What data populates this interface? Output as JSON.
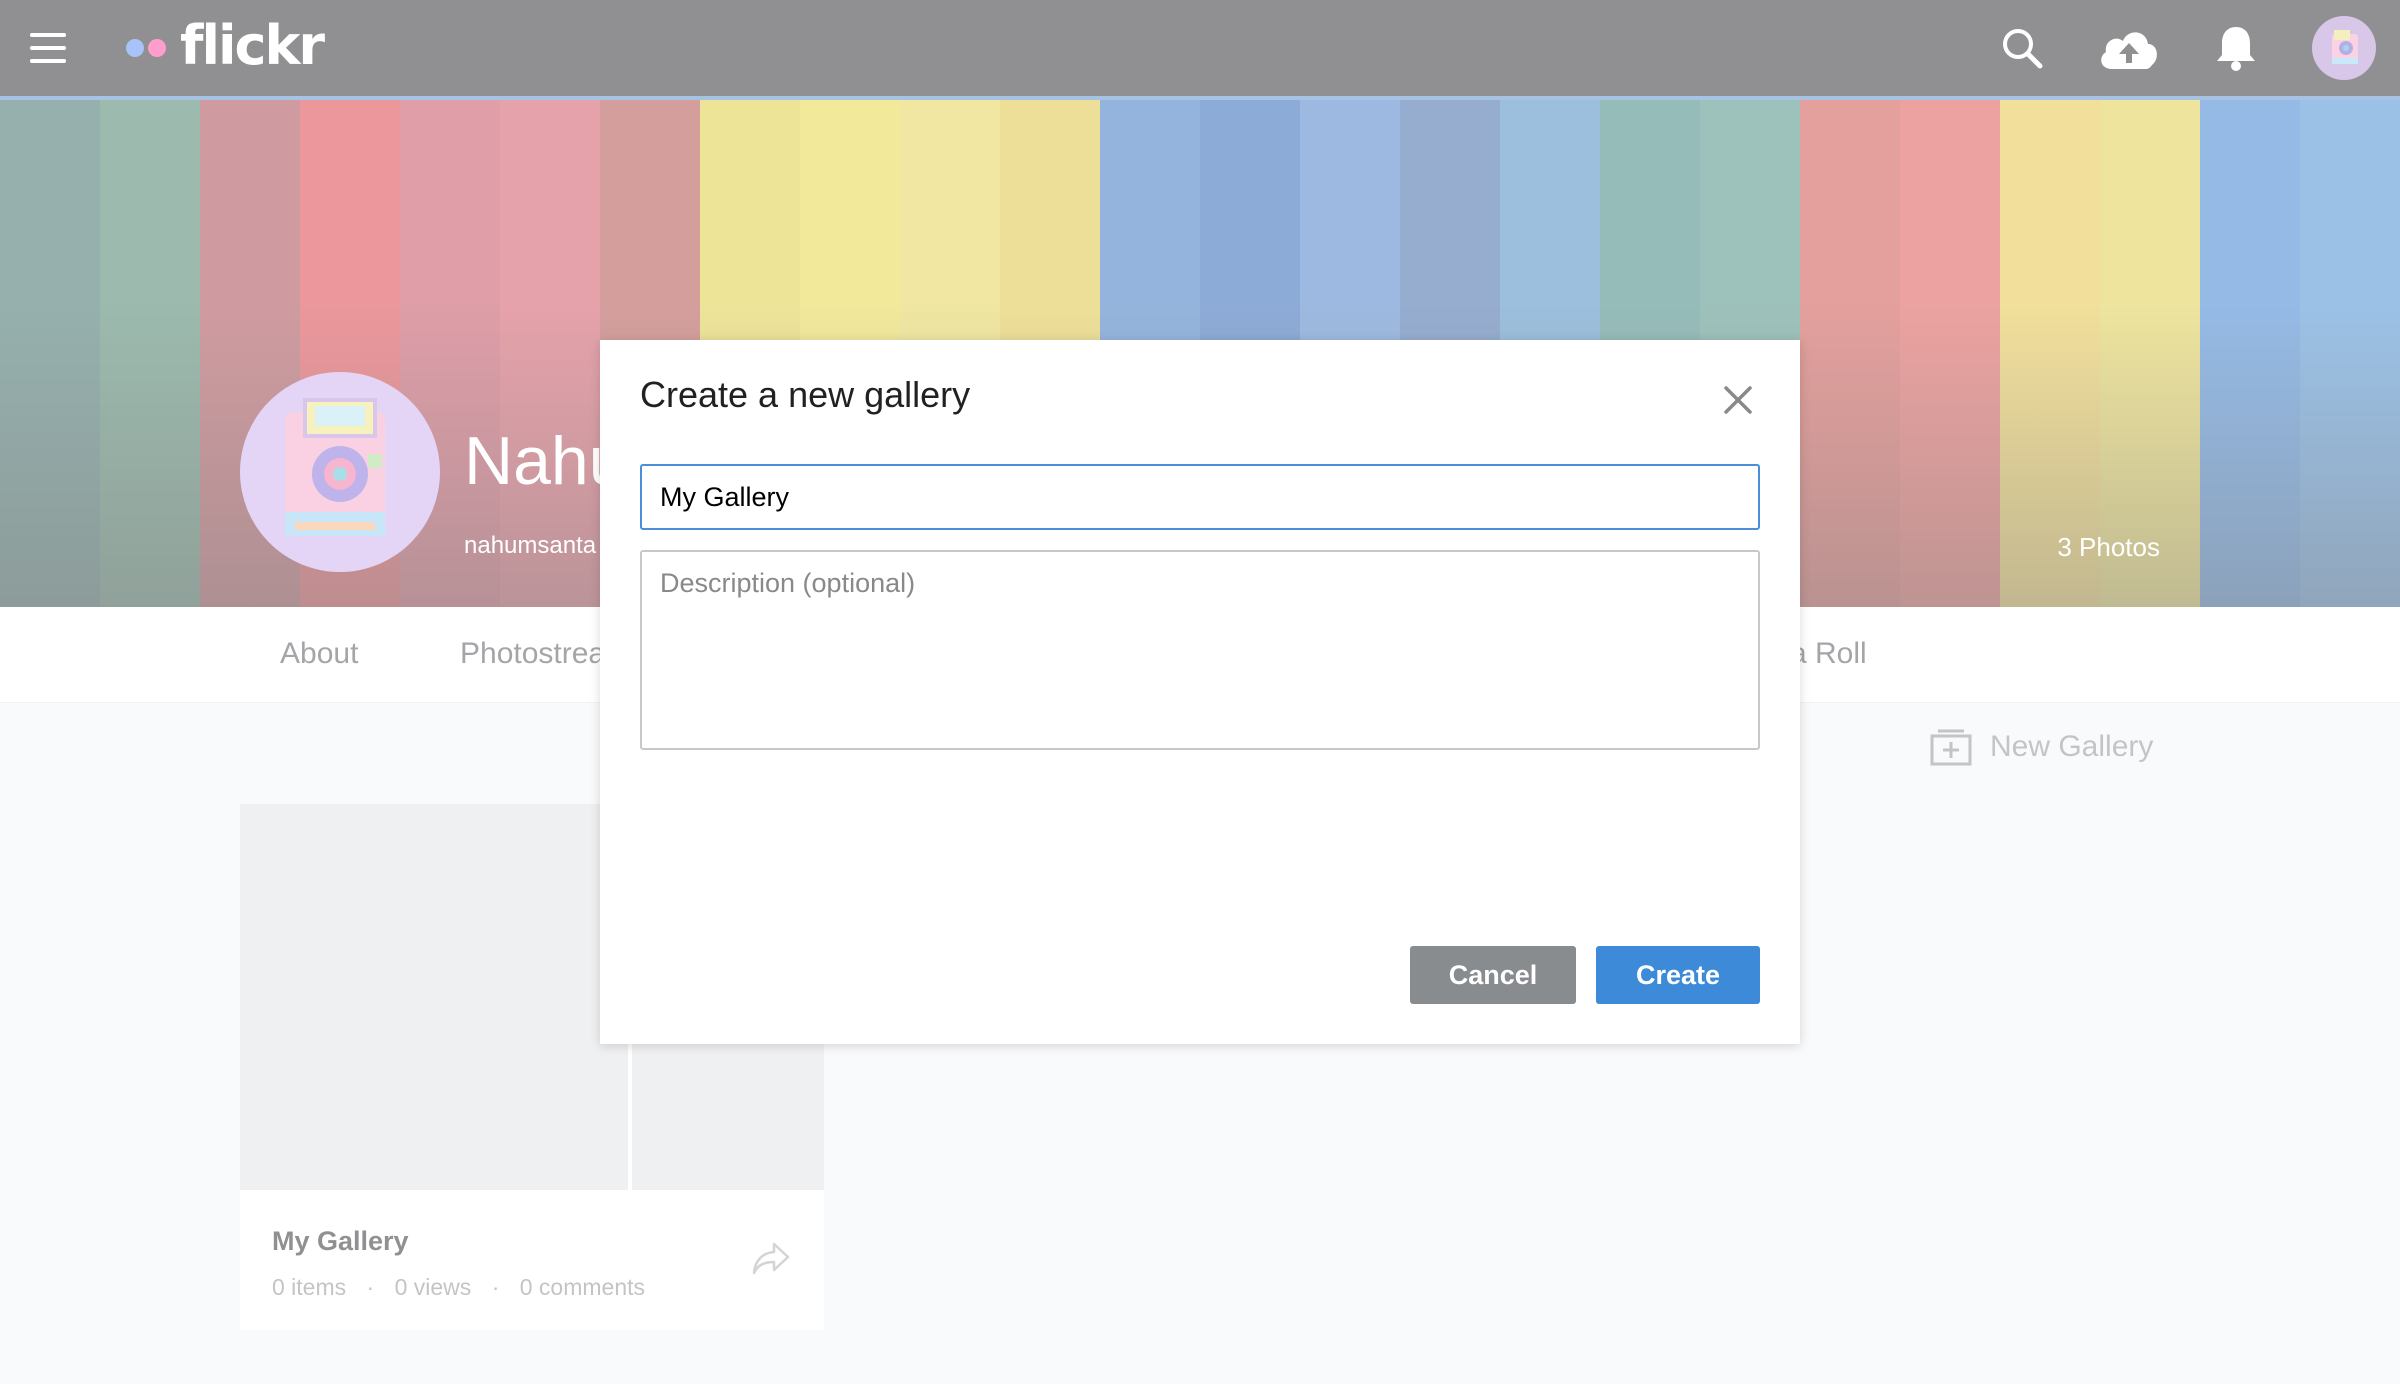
{
  "header": {
    "brand": "flickr",
    "colors": {
      "bar": "#212124",
      "dot_blue": "#4f86f0",
      "dot_pink": "#ff3c96"
    },
    "icons": [
      "hamburger-menu-icon",
      "search-icon",
      "cloud-upload-icon",
      "bell-icon",
      "user-avatar"
    ]
  },
  "profile": {
    "name": "Nahu",
    "handle": "nahumsanta",
    "photo_count": "3 Photos"
  },
  "subnav": {
    "tabs": [
      {
        "label": "About"
      },
      {
        "label": "Photostrea"
      },
      {
        "label": "a Roll"
      }
    ]
  },
  "galleries": {
    "new_gallery_label": "New Gallery",
    "items": [
      {
        "title": "My Gallery",
        "items": "0 items",
        "views": "0 views",
        "comments": "0 comments",
        "separator": "·"
      }
    ]
  },
  "modal": {
    "title": "Create a new gallery",
    "name_value": "My Gallery",
    "description_placeholder": "Description (optional)",
    "cancel_label": "Cancel",
    "create_label": "Create",
    "colors": {
      "create": "#3d8bd8",
      "cancel": "#898c8f",
      "focus": "#4c8fd6"
    }
  }
}
